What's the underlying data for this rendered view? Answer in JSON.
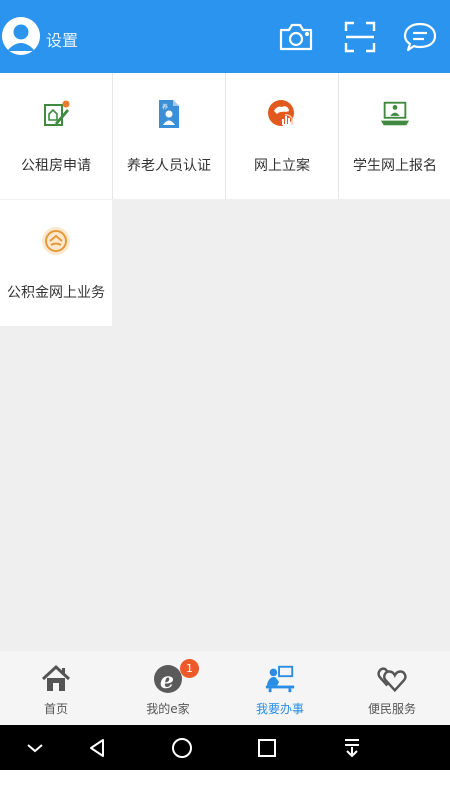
{
  "header": {
    "settings_label": "设置",
    "icons": [
      "avatar-icon",
      "camera-icon",
      "scan-icon",
      "message-icon"
    ],
    "background_color": "#2a94ee"
  },
  "services": [
    {
      "label": "公租房申请",
      "icon": "housing-application-icon"
    },
    {
      "label": "养老人员认证",
      "icon": "pension-verification-icon"
    },
    {
      "label": "网上立案",
      "icon": "online-filing-icon"
    },
    {
      "label": "学生网上报名",
      "icon": "student-registration-icon"
    },
    {
      "label": "公积金网上业务",
      "icon": "housing-fund-icon"
    }
  ],
  "tabbar": {
    "tabs": [
      {
        "label": "首页",
        "icon": "home-icon",
        "active": false
      },
      {
        "label": "我的e家",
        "icon": "my-ehome-icon",
        "active": false,
        "badge": "1"
      },
      {
        "label": "我要办事",
        "icon": "service-desk-icon",
        "active": true
      },
      {
        "label": "便民服务",
        "icon": "convenience-icon",
        "active": false
      }
    ],
    "active_color": "#2a8de4"
  },
  "system_nav": {
    "icons": [
      "collapse-icon",
      "back-icon",
      "home-circle-icon",
      "recents-icon",
      "notification-down-icon"
    ]
  }
}
